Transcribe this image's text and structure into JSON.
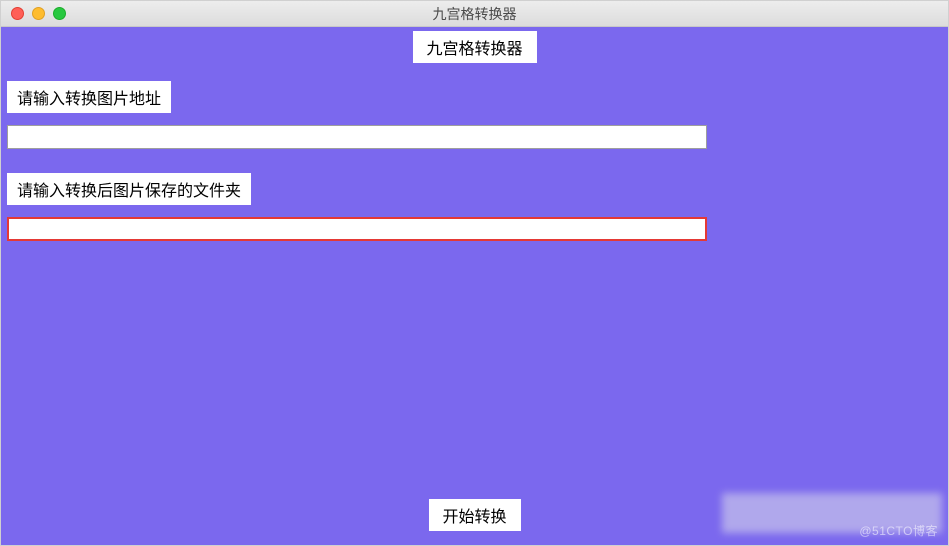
{
  "window": {
    "title": "九宫格转换器"
  },
  "header": {
    "label": "九宫格转换器"
  },
  "fields": {
    "input_path": {
      "label": "请输入转换图片地址",
      "value": ""
    },
    "output_path": {
      "label": "请输入转换后图片保存的文件夹",
      "value": ""
    }
  },
  "actions": {
    "start_label": "开始转换"
  },
  "watermark": "@51CTO博客"
}
